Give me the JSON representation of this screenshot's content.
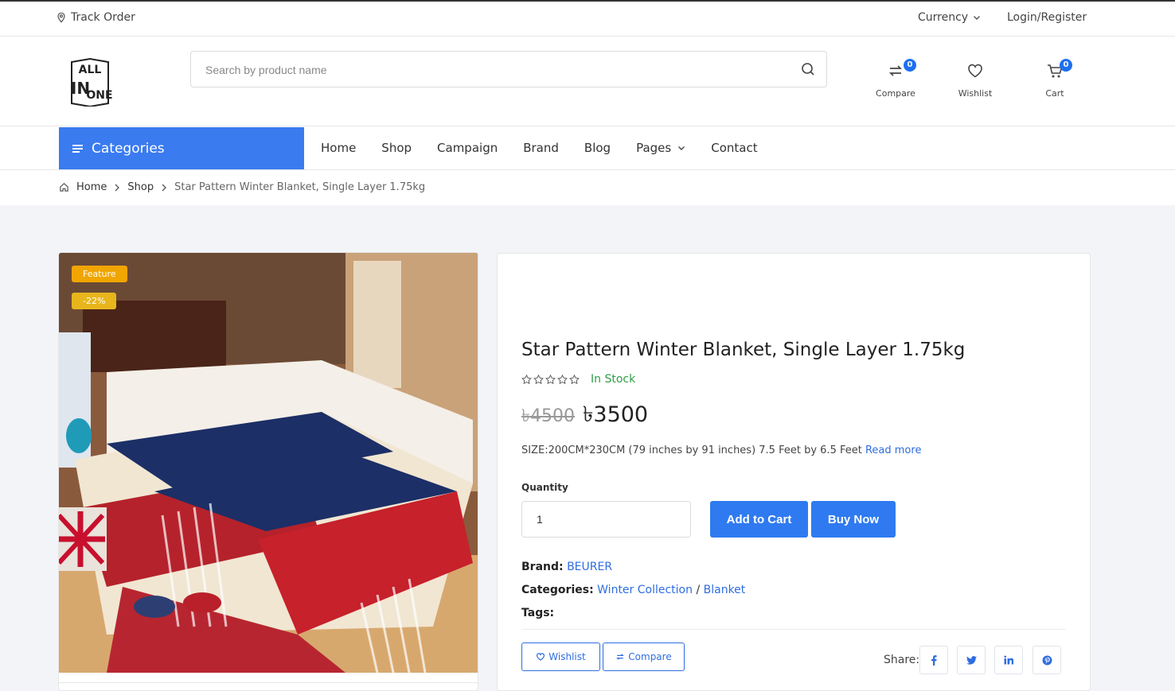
{
  "topbar": {
    "track_label": "Track Order",
    "currency_label": "Currency",
    "login_label": "Login/Register"
  },
  "logo": {
    "top_text": "ALL",
    "mid_text": "IN",
    "bottom_text": "ONE"
  },
  "search": {
    "placeholder": "Search by product name"
  },
  "header_icons": {
    "compare": {
      "label": "Compare",
      "count": "0"
    },
    "wishlist": {
      "label": "Wishlist"
    },
    "cart": {
      "label": "Cart",
      "count": "0"
    }
  },
  "nav": {
    "categories_label": "Categories",
    "items": [
      "Home",
      "Shop",
      "Campaign",
      "Brand",
      "Blog",
      "Pages",
      "Contact"
    ]
  },
  "breadcrumb": {
    "home": "Home",
    "shop": "Shop",
    "current": "Star Pattern Winter Blanket, Single Layer 1.75kg"
  },
  "product": {
    "feature_tag": "Feature",
    "discount_tag": "-22%",
    "title": "Star Pattern Winter Blanket, Single Layer 1.75kg",
    "rating_stars": 0,
    "stock": "In Stock",
    "old_price": "৳4500",
    "new_price": "৳3500",
    "description": "SIZE:200CM*230CM (79 inches by 91 inches) 7.5 Feet by 6.5 Feet",
    "read_more": "Read more",
    "quantity_label": "Quantity",
    "quantity_value": "1",
    "add_to_cart": "Add to Cart",
    "buy_now": "Buy Now",
    "brand_label": "Brand:",
    "brand_value": "BEURER",
    "categories_label": "Categories:",
    "category_1": "Winter Collection",
    "category_sep": "/",
    "category_2": "Blanket",
    "tags_label": "Tags:",
    "wishlist_btn": "Wishlist",
    "compare_btn": "Compare",
    "share_label": "Share:"
  },
  "colors": {
    "primary": "#2f7af0",
    "categories_bg": "#3a7bf0",
    "in_stock": "#2e9e47",
    "feature_tag": "#f0a500",
    "link": "#2f6de0"
  },
  "social_icons": [
    "facebook-icon",
    "twitter-icon",
    "linkedin-icon",
    "pinterest-icon"
  ]
}
